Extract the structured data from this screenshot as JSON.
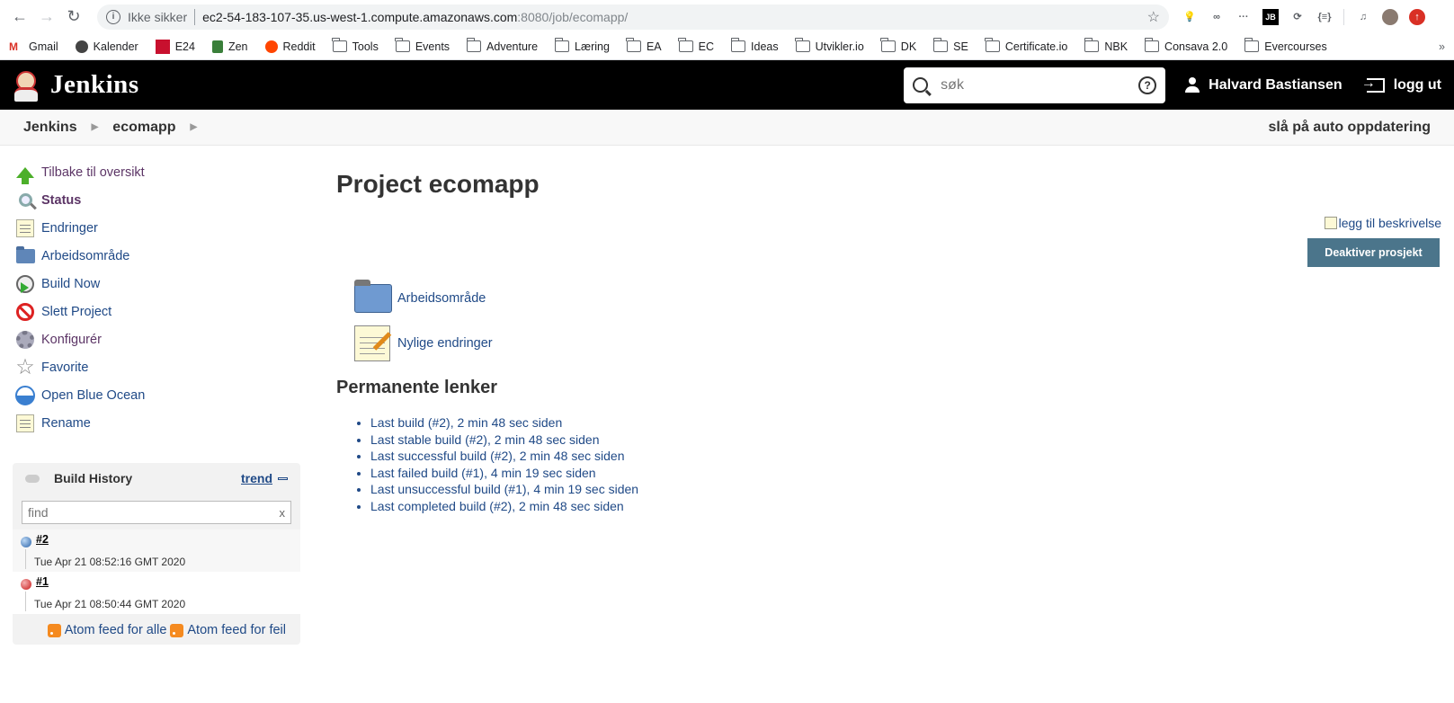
{
  "browser": {
    "insecure_label": "Ikke sikker",
    "url_host": "ec2-54-183-107-35.us-west-1.compute.amazonaws.com",
    "url_path": ":8080/job/ecomapp/",
    "extension_badge": "3"
  },
  "bookmarks": [
    {
      "label": "Gmail",
      "icon": "gmail-icon"
    },
    {
      "label": "Kalender",
      "icon": "calendar-icon"
    },
    {
      "label": "E24",
      "icon": "e24-icon"
    },
    {
      "label": "Zen",
      "icon": "zen-icon"
    },
    {
      "label": "Reddit",
      "icon": "reddit-icon"
    },
    {
      "label": "Tools",
      "icon": "folder-icon"
    },
    {
      "label": "Events",
      "icon": "folder-icon"
    },
    {
      "label": "Adventure",
      "icon": "folder-icon"
    },
    {
      "label": "Læring",
      "icon": "folder-icon"
    },
    {
      "label": "EA",
      "icon": "folder-icon"
    },
    {
      "label": "EC",
      "icon": "folder-icon"
    },
    {
      "label": "Ideas",
      "icon": "folder-icon"
    },
    {
      "label": "Utvikler.io",
      "icon": "folder-icon"
    },
    {
      "label": "DK",
      "icon": "folder-icon"
    },
    {
      "label": "SE",
      "icon": "folder-icon"
    },
    {
      "label": "Certificate.io",
      "icon": "folder-icon"
    },
    {
      "label": "NBK",
      "icon": "folder-icon"
    },
    {
      "label": "Consava 2.0",
      "icon": "folder-icon"
    },
    {
      "label": "Evercourses",
      "icon": "folder-icon"
    }
  ],
  "header": {
    "title": "Jenkins",
    "search_placeholder": "søk",
    "user": "Halvard Bastiansen",
    "logout": "logg ut"
  },
  "breadcrumbs": {
    "items": [
      "Jenkins",
      "ecomapp"
    ],
    "auto_refresh": "slå på auto oppdatering"
  },
  "sidebar": {
    "tasks": [
      {
        "label": "Tilbake til oversikt",
        "icon": "up-arrow-icon"
      },
      {
        "label": "Status",
        "icon": "magnifier-icon"
      },
      {
        "label": "Endringer",
        "icon": "notepad-icon"
      },
      {
        "label": "Arbeidsområde",
        "icon": "folder-icon"
      },
      {
        "label": "Build Now",
        "icon": "clock-play-icon"
      },
      {
        "label": "Slett Project",
        "icon": "no-entry-icon"
      },
      {
        "label": "Konfigurér",
        "icon": "gear-icon"
      },
      {
        "label": "Favorite",
        "icon": "star-icon"
      },
      {
        "label": "Open Blue Ocean",
        "icon": "blue-ocean-icon"
      },
      {
        "label": "Rename",
        "icon": "notepad-icon"
      }
    ]
  },
  "build_history": {
    "title": "Build History",
    "trend": "trend",
    "find_placeholder": "find",
    "clear": "x",
    "builds": [
      {
        "number": "#2",
        "date": "Tue Apr 21 08:52:16 GMT 2020",
        "status": "success"
      },
      {
        "number": "#1",
        "date": "Tue Apr 21 08:50:44 GMT 2020",
        "status": "failed"
      }
    ],
    "feed_all": "Atom feed for alle",
    "feed_failed": "Atom feed for feil"
  },
  "main": {
    "title": "Project ecomapp",
    "add_description": "legg til beskrivelse",
    "disable_button": "Deaktiver prosjekt",
    "links": [
      {
        "label": "Arbeidsområde",
        "icon": "folder-icon"
      },
      {
        "label": "Nylige endringer",
        "icon": "notepad-icon"
      }
    ],
    "permalinks_title": "Permanente lenker",
    "permalinks": [
      "Last build (#2), 2 min 48 sec siden",
      "Last stable build (#2), 2 min 48 sec siden",
      "Last successful build (#2), 2 min 48 sec siden",
      "Last failed build (#1), 4 min 19 sec siden",
      "Last unsuccessful build (#1), 4 min 19 sec siden",
      "Last completed build (#2), 2 min 48 sec siden"
    ]
  }
}
